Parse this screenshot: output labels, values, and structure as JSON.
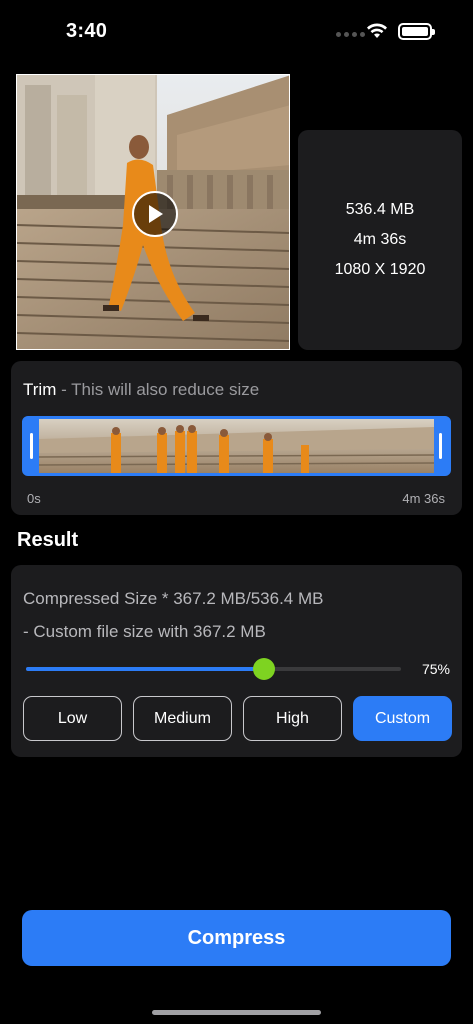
{
  "status_bar": {
    "time": "3:40",
    "icons": [
      "cellular-dots-icon",
      "wifi-icon",
      "battery-icon"
    ]
  },
  "video": {
    "play_icon": "play-icon",
    "size": "536.4 MB",
    "duration": "4m 36s",
    "resolution": "1080 X 1920"
  },
  "trim": {
    "title": "Trim",
    "subtitle": " - This will also reduce size",
    "start_label": "0s",
    "end_label": "4m 36s"
  },
  "result": {
    "heading": "Result",
    "compressed_size": "Compressed Size * 367.2 MB/536.4 MB",
    "custom_note": "- Custom file size with 367.2 MB",
    "slider_value": 0.75,
    "slider_label": "75%",
    "levels": [
      {
        "label": "Low",
        "selected": false
      },
      {
        "label": "Medium",
        "selected": false
      },
      {
        "label": "High",
        "selected": false
      },
      {
        "label": "Custom",
        "selected": true
      }
    ]
  },
  "compress_button": "Compress",
  "colors": {
    "accent": "#2c7cf6",
    "slider_knob": "#7ed321",
    "card": "#1c1c1e",
    "background": "#000000"
  }
}
